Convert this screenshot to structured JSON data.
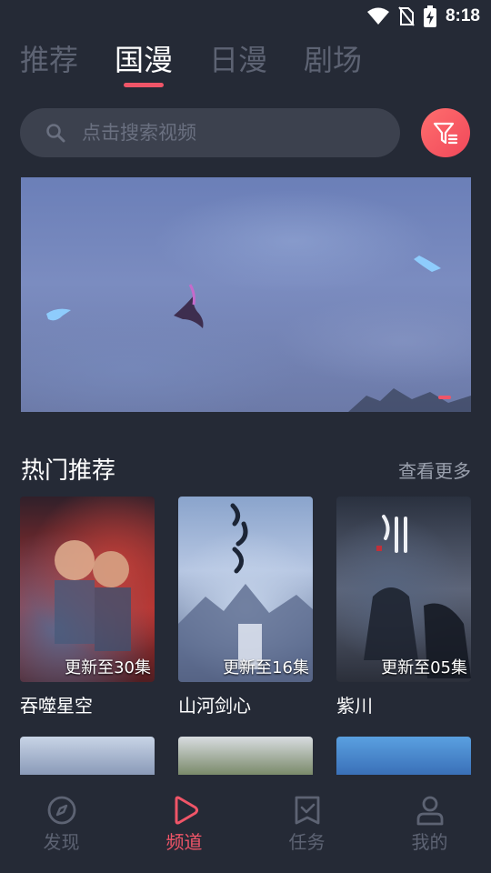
{
  "status": {
    "time": "8:18"
  },
  "tabs": [
    {
      "label": "推荐"
    },
    {
      "label": "国漫"
    },
    {
      "label": "日漫"
    },
    {
      "label": "剧场"
    }
  ],
  "active_tab": "国漫",
  "search": {
    "placeholder": "点击搜索视频"
  },
  "section": {
    "title": "热门推荐",
    "more": "查看更多"
  },
  "cards": [
    {
      "title": "吞噬星空",
      "badge": "更新至30集"
    },
    {
      "title": "山河剑心",
      "badge": "更新至16集"
    },
    {
      "title": "紫川",
      "badge": "更新至05集"
    }
  ],
  "bottom_nav": [
    {
      "label": "发现",
      "icon": "compass-icon"
    },
    {
      "label": "频道",
      "icon": "play-icon"
    },
    {
      "label": "任务",
      "icon": "task-icon"
    },
    {
      "label": "我的",
      "icon": "user-icon"
    }
  ],
  "active_nav": "频道",
  "colors": {
    "accent": "#f05568",
    "background": "#252a36",
    "inactive": "#5d6373"
  }
}
